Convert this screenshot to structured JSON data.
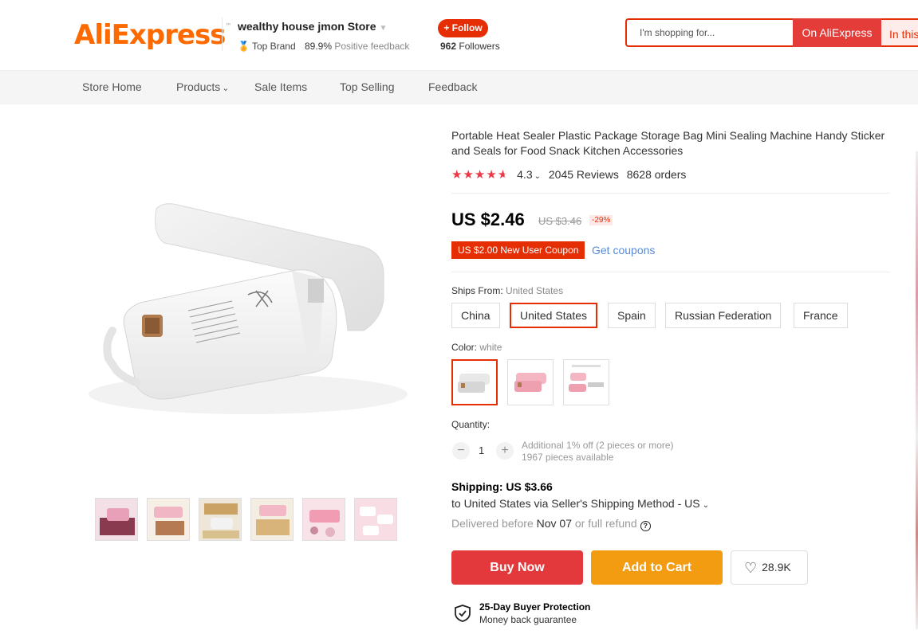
{
  "header": {
    "logo_ali": "Ali",
    "logo_express": "Express",
    "store_name": "wealthy house jmon Store",
    "top_brand": "Top Brand",
    "positive_pct": "89.9%",
    "positive_label": "Positive feedback",
    "follow_label": "+ Follow",
    "followers_count": "962",
    "followers_label": "Followers",
    "search_placeholder": "I'm shopping for...",
    "search_ali_label": "On AliExpress",
    "search_store_label": "In this store"
  },
  "nav": {
    "items": [
      "Store Home",
      "Products",
      "Sale Items",
      "Top Selling",
      "Feedback"
    ]
  },
  "product": {
    "title": "Portable Heat Sealer Plastic Package Storage Bag Mini Sealing Machine Handy Sticker and Seals for Food Snack Kitchen Accessories",
    "rating_value": 4.3,
    "rating": "4.3",
    "reviews": "2045 Reviews",
    "orders": "8628 orders",
    "price": "US $2.46",
    "old_price": "US $3.46",
    "discount": "-29%",
    "coupon": "US $2.00 New User Coupon",
    "get_coupons": "Get coupons",
    "ships_from_label": "Ships From:",
    "ships_from_value": "United States",
    "ship_options": [
      "China",
      "United States",
      "Spain",
      "Russian Federation",
      "France"
    ],
    "ship_selected": "United States",
    "color_label": "Color:",
    "color_value": "white",
    "colors": [
      "white",
      "pink",
      "pink-bundle"
    ],
    "quantity_label": "Quantity:",
    "quantity": "1",
    "qty_note_1": "Additional 1% off (2 pieces or more)",
    "qty_note_2": "1967 pieces available",
    "shipping_title": "Shipping: US $3.66",
    "shipping_line": "to United States via Seller's Shipping Method - US",
    "delivered_before": "Delivered before",
    "delivery_date": "Nov 07",
    "or_refund": "or full refund",
    "buy_now": "Buy Now",
    "add_to_cart": "Add to Cart",
    "wishlist_count": "28.9K",
    "protection_title": "25-Day Buyer Protection",
    "protection_sub": "Money back guarantee"
  },
  "colors": {
    "brand_orange": "#ff6a00",
    "brand_red": "#e62e04",
    "buy_now": "#e4393c",
    "add_cart": "#f39c12",
    "link_blue": "#2e6fd3"
  },
  "icons": [
    "chevron-down-icon",
    "medal-icon",
    "star-icon",
    "heart-icon",
    "help-icon",
    "shield-check-icon",
    "minus-icon",
    "plus-icon"
  ]
}
